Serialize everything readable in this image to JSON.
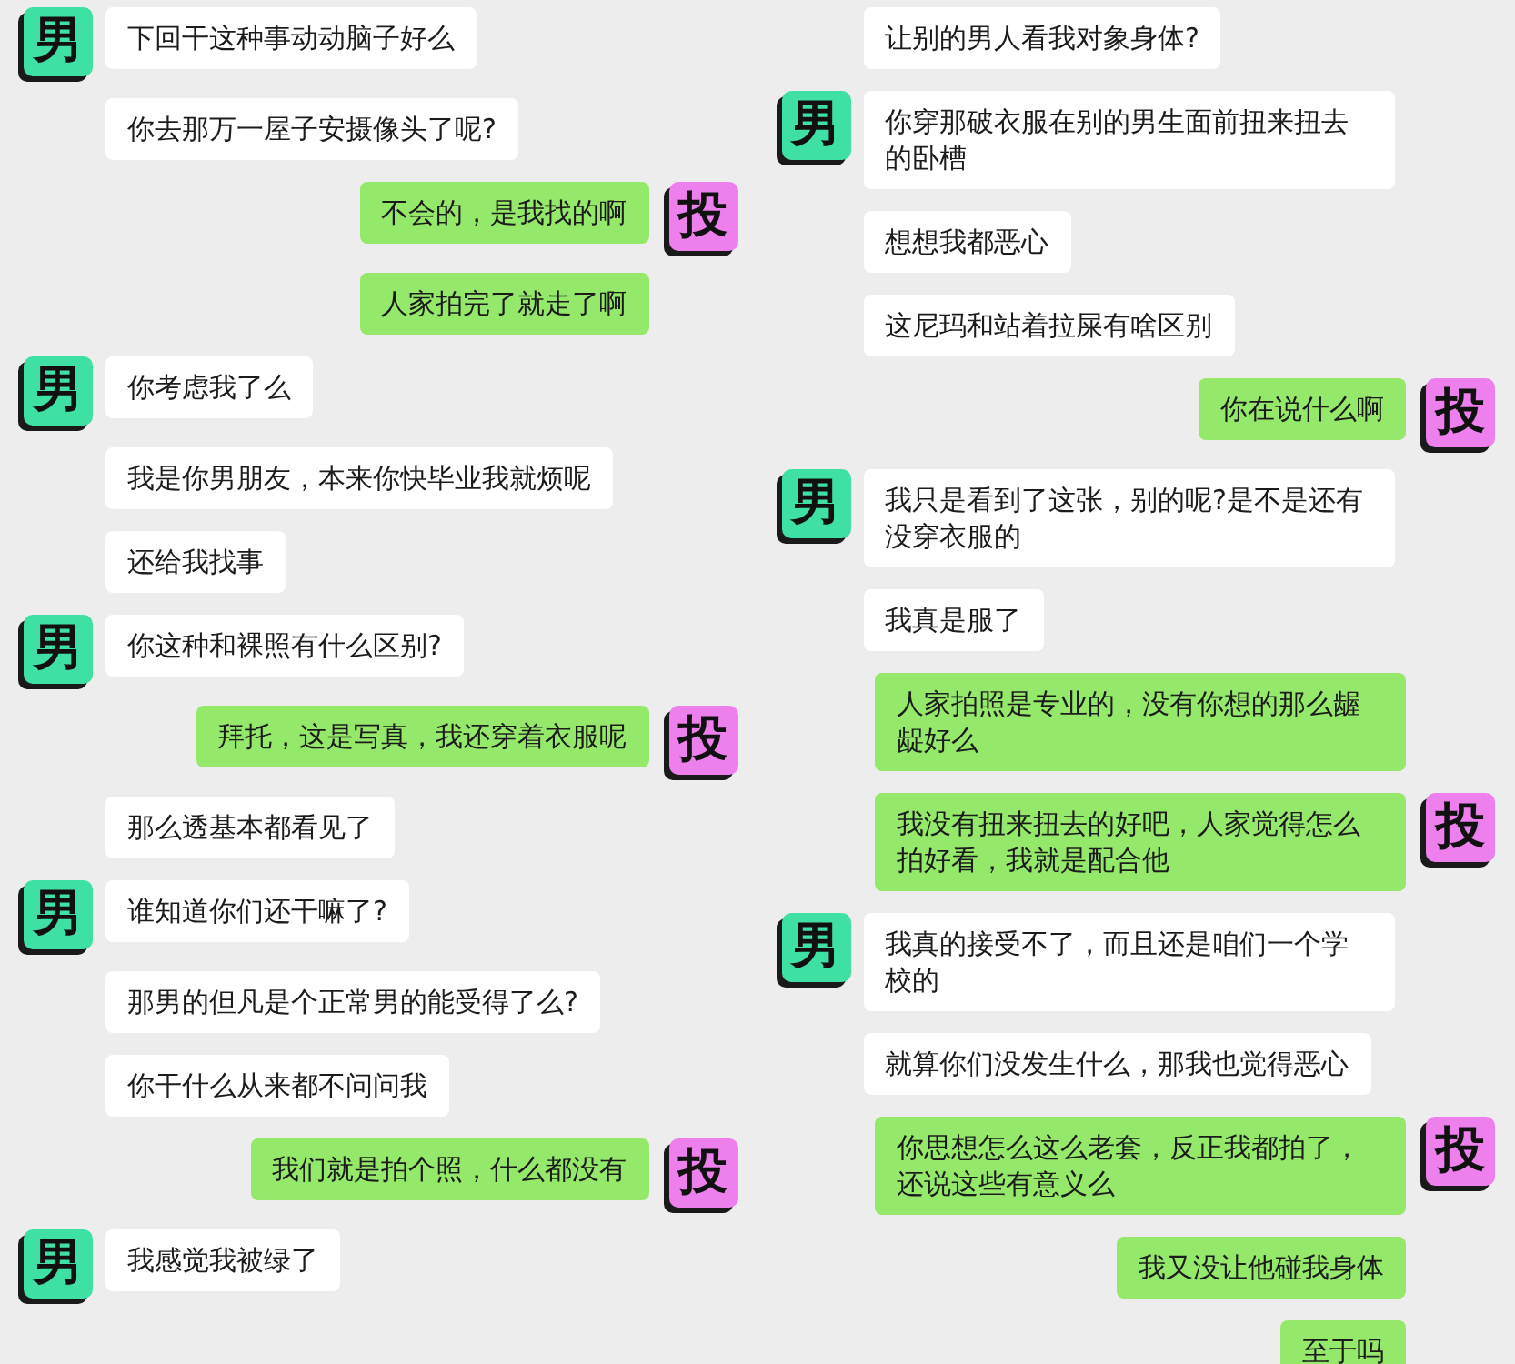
{
  "columns": [
    {
      "messages": [
        {
          "kind": "received",
          "avatar": "男",
          "text": "下回干这种事动动脑子好么"
        },
        {
          "kind": "received",
          "text": "你去那万一屋子安摄像头了呢?"
        },
        {
          "kind": "sent",
          "avatar": "投",
          "text": "不会的，是我找的啊"
        },
        {
          "kind": "sent",
          "text": "人家拍完了就走了啊"
        },
        {
          "kind": "received",
          "avatar": "男",
          "text": "你考虑我了么"
        },
        {
          "kind": "received",
          "text": "我是你男朋友，本来你快毕业我就烦呢"
        },
        {
          "kind": "received",
          "text": "还给我找事"
        },
        {
          "kind": "received",
          "avatar": "男",
          "text": "你这种和裸照有什么区别?"
        },
        {
          "kind": "sent",
          "avatar": "投",
          "text": "拜托，这是写真，我还穿着衣服呢"
        },
        {
          "kind": "received",
          "text": "那么透基本都看见了"
        },
        {
          "kind": "received",
          "avatar": "男",
          "text": "谁知道你们还干嘛了?"
        },
        {
          "kind": "received",
          "text": "那男的但凡是个正常男的能受得了么?"
        },
        {
          "kind": "received",
          "text": "你干什么从来都不问问我"
        },
        {
          "kind": "sent",
          "avatar": "投",
          "text": "我们就是拍个照，什么都没有"
        },
        {
          "kind": "received",
          "avatar": "男",
          "text": "我感觉我被绿了"
        }
      ]
    },
    {
      "messages": [
        {
          "kind": "received",
          "text": "让别的男人看我对象身体?"
        },
        {
          "kind": "received",
          "avatar": "男",
          "text": "你穿那破衣服在别的男生面前扭来扭去的卧槽"
        },
        {
          "kind": "received",
          "text": "想想我都恶心"
        },
        {
          "kind": "received",
          "text": "这尼玛和站着拉屎有啥区别"
        },
        {
          "kind": "sent",
          "avatar": "投",
          "text": "你在说什么啊"
        },
        {
          "kind": "received",
          "avatar": "男",
          "text": "我只是看到了这张，别的呢?是不是还有没穿衣服的"
        },
        {
          "kind": "received",
          "text": "我真是服了"
        },
        {
          "kind": "sent",
          "text": "人家拍照是专业的，没有你想的那么龌龊好么"
        },
        {
          "kind": "sent",
          "avatar": "投",
          "text": "我没有扭来扭去的好吧，人家觉得怎么拍好看，我就是配合他"
        },
        {
          "kind": "received",
          "avatar": "男",
          "text": "我真的接受不了，而且还是咱们一个学校的"
        },
        {
          "kind": "received",
          "text": "就算你们没发生什么，那我也觉得恶心"
        },
        {
          "kind": "sent",
          "avatar": "投",
          "text": "你思想怎么这么老套，反正我都拍了，还说这些有意义么"
        },
        {
          "kind": "sent",
          "text": "我又没让他碰我身体"
        },
        {
          "kind": "sent",
          "text": "至于吗"
        }
      ]
    }
  ]
}
